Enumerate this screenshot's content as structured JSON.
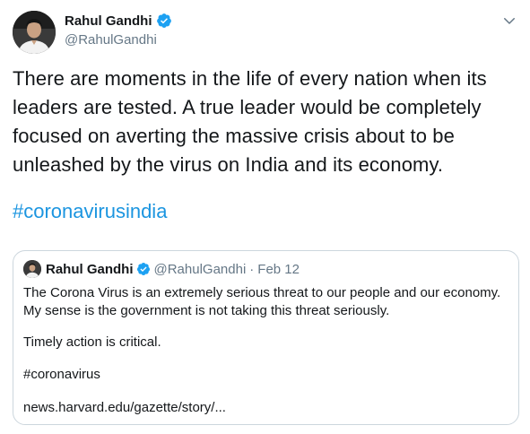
{
  "tweet": {
    "author": {
      "name": "Rahul Gandhi",
      "handle": "@RahulGandhi"
    },
    "text_lines": [
      "There are moments in the life of every nation when its",
      "leaders are tested. A true leader would be completely",
      "focused on averting the massive crisis about to be",
      "unleashed by the virus on India and its economy."
    ],
    "hashtag": "#coronavirusindia",
    "quoted": {
      "name": "Rahul Gandhi",
      "handle": "@RahulGandhi",
      "separator": "·",
      "date": "Feb 12",
      "lines": [
        "The Corona Virus is an extremely serious threat to our people and our economy.",
        "My sense is the government is not taking this threat seriously.",
        "Timely action is critical.",
        "#coronavirus",
        "news.harvard.edu/gazette/story/..."
      ]
    }
  },
  "colors": {
    "text": "#14171a",
    "secondary": "#657786",
    "link": "#1b95e0",
    "verified": "#1da1f2",
    "border": "#ccd6dd"
  },
  "icons": {
    "verified": "verified-badge-icon",
    "caret": "chevron-down-icon"
  }
}
